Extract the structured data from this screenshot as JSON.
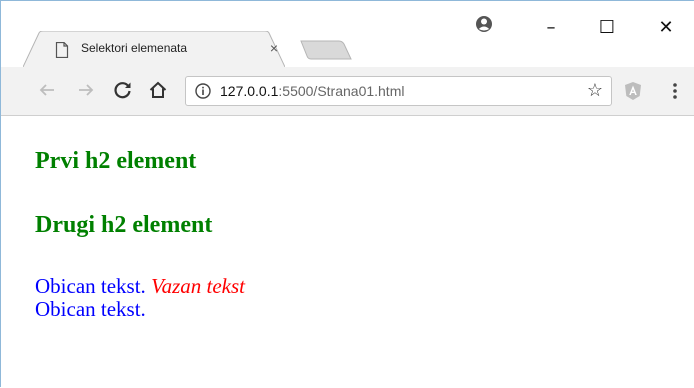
{
  "browser": {
    "tab": {
      "title": "Selektori elemenata",
      "close_glyph": "×"
    },
    "window_controls": {
      "minimize": "–",
      "maximize": "☐",
      "close": "✕"
    },
    "toolbar": {
      "url_host": "127.0.0.1",
      "url_rest": ":5500/Strana01.html",
      "bookmark_glyph": "☆"
    },
    "icons": [
      "page-icon",
      "account-icon",
      "back-arrow-icon",
      "forward-arrow-icon",
      "reload-icon",
      "home-icon",
      "info-icon",
      "star-icon",
      "angular-extension-icon",
      "menu-dots-icon"
    ]
  },
  "page": {
    "heading_1": "Prvi h2 element",
    "heading_2": "Drugi h2 element",
    "paragraph_1_plain": "Obican tekst.",
    "paragraph_1_emphasis": "Vazan tekst",
    "paragraph_2": "Obican tekst."
  },
  "colors": {
    "heading": "#008000",
    "paragraph": "#0000ff",
    "emphasis": "#ff0000",
    "window_border": "#8fb8d9"
  }
}
